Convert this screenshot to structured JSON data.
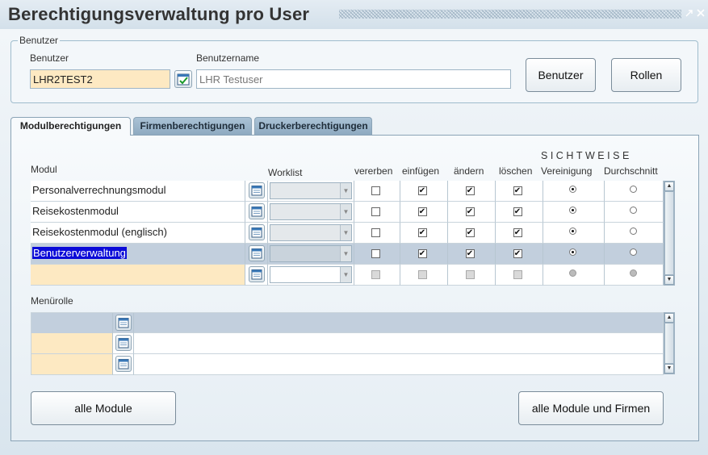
{
  "window": {
    "title": "Berechtigungsverwaltung pro User"
  },
  "user_group": {
    "legend": "Benutzer",
    "user_label": "Benutzer",
    "user_value": "LHR2TEST2",
    "username_label": "Benutzername",
    "username_value": "LHR Testuser",
    "btn_user": "Benutzer",
    "btn_roles": "Rollen"
  },
  "tabs": [
    {
      "label": "Modulberechtigungen",
      "active": true
    },
    {
      "label": "Firmenberechtigungen",
      "active": false
    },
    {
      "label": "Druckerberechtigungen",
      "active": false
    }
  ],
  "grid": {
    "col_modul": "Modul",
    "col_worklist": "Worklist",
    "col_vererben": "vererben",
    "col_einfuegen": "einfügen",
    "col_aendern": "ändern",
    "col_loeschen": "löschen",
    "group_sichtweise": "SICHTWEISE",
    "col_vereinigung": "Vereinigung",
    "col_durchschnitt": "Durchschnitt",
    "rows": [
      {
        "modul": "Personalverrechnungsmodul",
        "worklist": "",
        "vererben": false,
        "einfuegen": true,
        "aendern": true,
        "loeschen": true,
        "sichtweise": "Vereinigung",
        "selected": false,
        "empty": false
      },
      {
        "modul": "Reisekostenmodul",
        "worklist": "",
        "vererben": false,
        "einfuegen": true,
        "aendern": true,
        "loeschen": true,
        "sichtweise": "Vereinigung",
        "selected": false,
        "empty": false
      },
      {
        "modul": "Reisekostenmodul (englisch)",
        "worklist": "",
        "vererben": false,
        "einfuegen": true,
        "aendern": true,
        "loeschen": true,
        "sichtweise": "Vereinigung",
        "selected": false,
        "empty": false
      },
      {
        "modul": "Benutzerverwaltung",
        "worklist": "",
        "vererben": false,
        "einfuegen": true,
        "aendern": true,
        "loeschen": true,
        "sichtweise": "Vereinigung",
        "selected": true,
        "empty": false
      },
      {
        "modul": "",
        "worklist": "",
        "vererben": false,
        "einfuegen": false,
        "aendern": false,
        "loeschen": false,
        "sichtweise": "",
        "selected": false,
        "empty": true
      }
    ]
  },
  "menurolle": {
    "label": "Menürolle",
    "rows": [
      {
        "value": "",
        "selected": true
      },
      {
        "value": "",
        "selected": false
      },
      {
        "value": "",
        "selected": false
      }
    ]
  },
  "buttons": {
    "all_modules": "alle Module",
    "all_modules_firms": "alle Module und Firmen"
  },
  "colors": {
    "row_selected": "#c2cfdd",
    "row_new": "#fde9c2",
    "input_highlight": "#fde9c2",
    "tab_inactive": "#8eaac1"
  }
}
